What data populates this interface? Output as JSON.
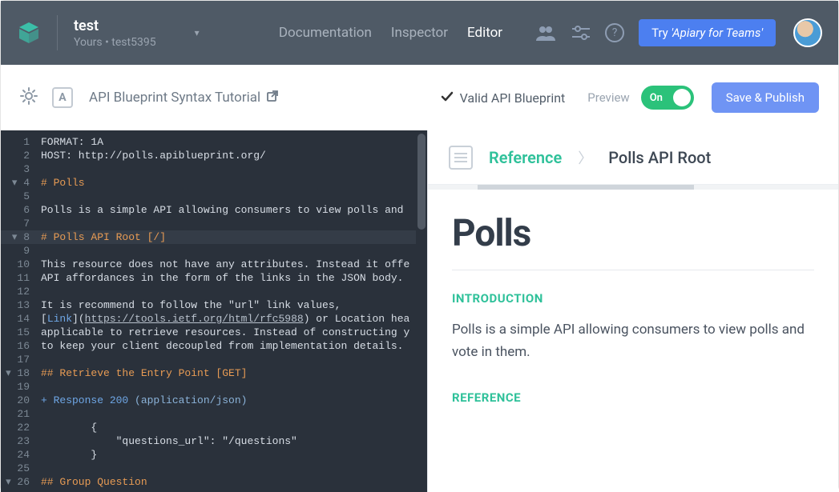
{
  "header": {
    "project_name": "test",
    "project_sub": "Yours • test5395",
    "nav": {
      "documentation": "Documentation",
      "inspector": "Inspector",
      "editor": "Editor"
    },
    "cta_prefix": "Try ",
    "cta_em": "'Apiary for Teams'"
  },
  "toolbar": {
    "a_badge": "A",
    "tutorial": "API Blueprint Syntax Tutorial",
    "valid": "Valid API Blueprint",
    "preview": "Preview",
    "toggle": "On",
    "publish": "Save & Publish"
  },
  "editor": {
    "lines": [
      {
        "n": "1",
        "t": "FORMAT: 1A"
      },
      {
        "n": "2",
        "t": "HOST: http://polls.apiblueprint.org/"
      },
      {
        "n": "3",
        "t": ""
      },
      {
        "n": "4",
        "fold": true,
        "html": "<span class='tok-head'># Polls</span>"
      },
      {
        "n": "5",
        "t": ""
      },
      {
        "n": "6",
        "t": "Polls is a simple API allowing consumers to view polls and "
      },
      {
        "n": "7",
        "t": ""
      },
      {
        "n": "8",
        "fold": true,
        "hl": true,
        "html": "<span class='tok-head'># Polls API Root [/]</span>"
      },
      {
        "n": "9",
        "t": ""
      },
      {
        "n": "10",
        "t": "This resource does not have any attributes. Instead it offe"
      },
      {
        "n": "11",
        "t": "API affordances in the form of the links in the JSON body."
      },
      {
        "n": "12",
        "t": ""
      },
      {
        "n": "13",
        "t": "It is recommend to follow the \"url\" link values,"
      },
      {
        "n": "14",
        "html": "[<span class='tok-link'>Link</span>](<span class='tok-url'>https://tools.ietf.org/html/rfc5988</span>) or Location hea"
      },
      {
        "n": "15",
        "t": "applicable to retrieve resources. Instead of constructing y"
      },
      {
        "n": "16",
        "t": "to keep your client decoupled from implementation details."
      },
      {
        "n": "17",
        "t": ""
      },
      {
        "n": "18",
        "fold": true,
        "html": "<span class='tok-head'>## Retrieve the Entry Point [GET]</span>"
      },
      {
        "n": "19",
        "t": ""
      },
      {
        "n": "20",
        "html": "<span class='tok-plus'>+ Response 200 </span><span class='tok-paren'>(application/json)</span>"
      },
      {
        "n": "21",
        "t": ""
      },
      {
        "n": "22",
        "t": "        {"
      },
      {
        "n": "23",
        "t": "            \"questions_url\": \"/questions\""
      },
      {
        "n": "24",
        "t": "        }"
      },
      {
        "n": "25",
        "t": ""
      },
      {
        "n": "26",
        "fold": true,
        "html": "<span class='tok-head'>## Group Question</span>"
      }
    ]
  },
  "preview": {
    "crumb_ref": "Reference",
    "crumb_current": "Polls API Root",
    "title": "Polls",
    "intro_label": "INTRODUCTION",
    "intro_text": "Polls is a simple API allowing consumers to view polls and vote in them.",
    "ref_label": "REFERENCE"
  }
}
